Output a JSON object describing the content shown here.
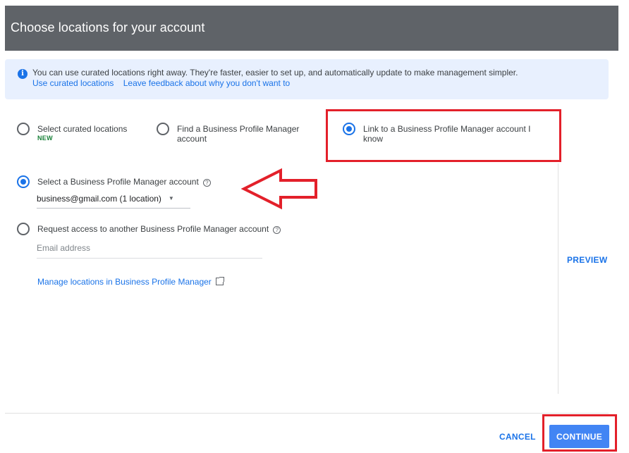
{
  "dialog": {
    "title": "Choose locations for your account"
  },
  "banner": {
    "message": "You can use curated locations right away. They're faster, easier to set up, and automatically update to make management simpler.",
    "link_use": "Use curated locations",
    "link_feedback": "Leave feedback about why you don't want to"
  },
  "options": [
    {
      "label": "Select curated locations",
      "badge": "NEW",
      "selected": false
    },
    {
      "label": "Find a Business Profile Manager account",
      "selected": false
    },
    {
      "label": "Link to a Business Profile Manager account I know",
      "selected": true
    }
  ],
  "account": {
    "select_label": "Select a Business Profile Manager account",
    "selected_value": "business@gmail.com (1 location)",
    "request_label": "Request access to another Business Profile Manager account",
    "email_placeholder": "Email address",
    "manage_link": "Manage locations in Business Profile Manager"
  },
  "preview_label": "PREVIEW",
  "footer": {
    "cancel": "CANCEL",
    "continue": "CONTINUE"
  },
  "colors": {
    "header_bg": "#5f6368",
    "accent": "#1a73e8",
    "banner_bg": "#e8f0fe",
    "annotation": "#e3202a",
    "continue_bg": "#4285f4"
  },
  "icons": [
    "info-icon",
    "help-icon",
    "external-link-icon",
    "dropdown-caret-icon",
    "annotation-arrow-icon"
  ]
}
